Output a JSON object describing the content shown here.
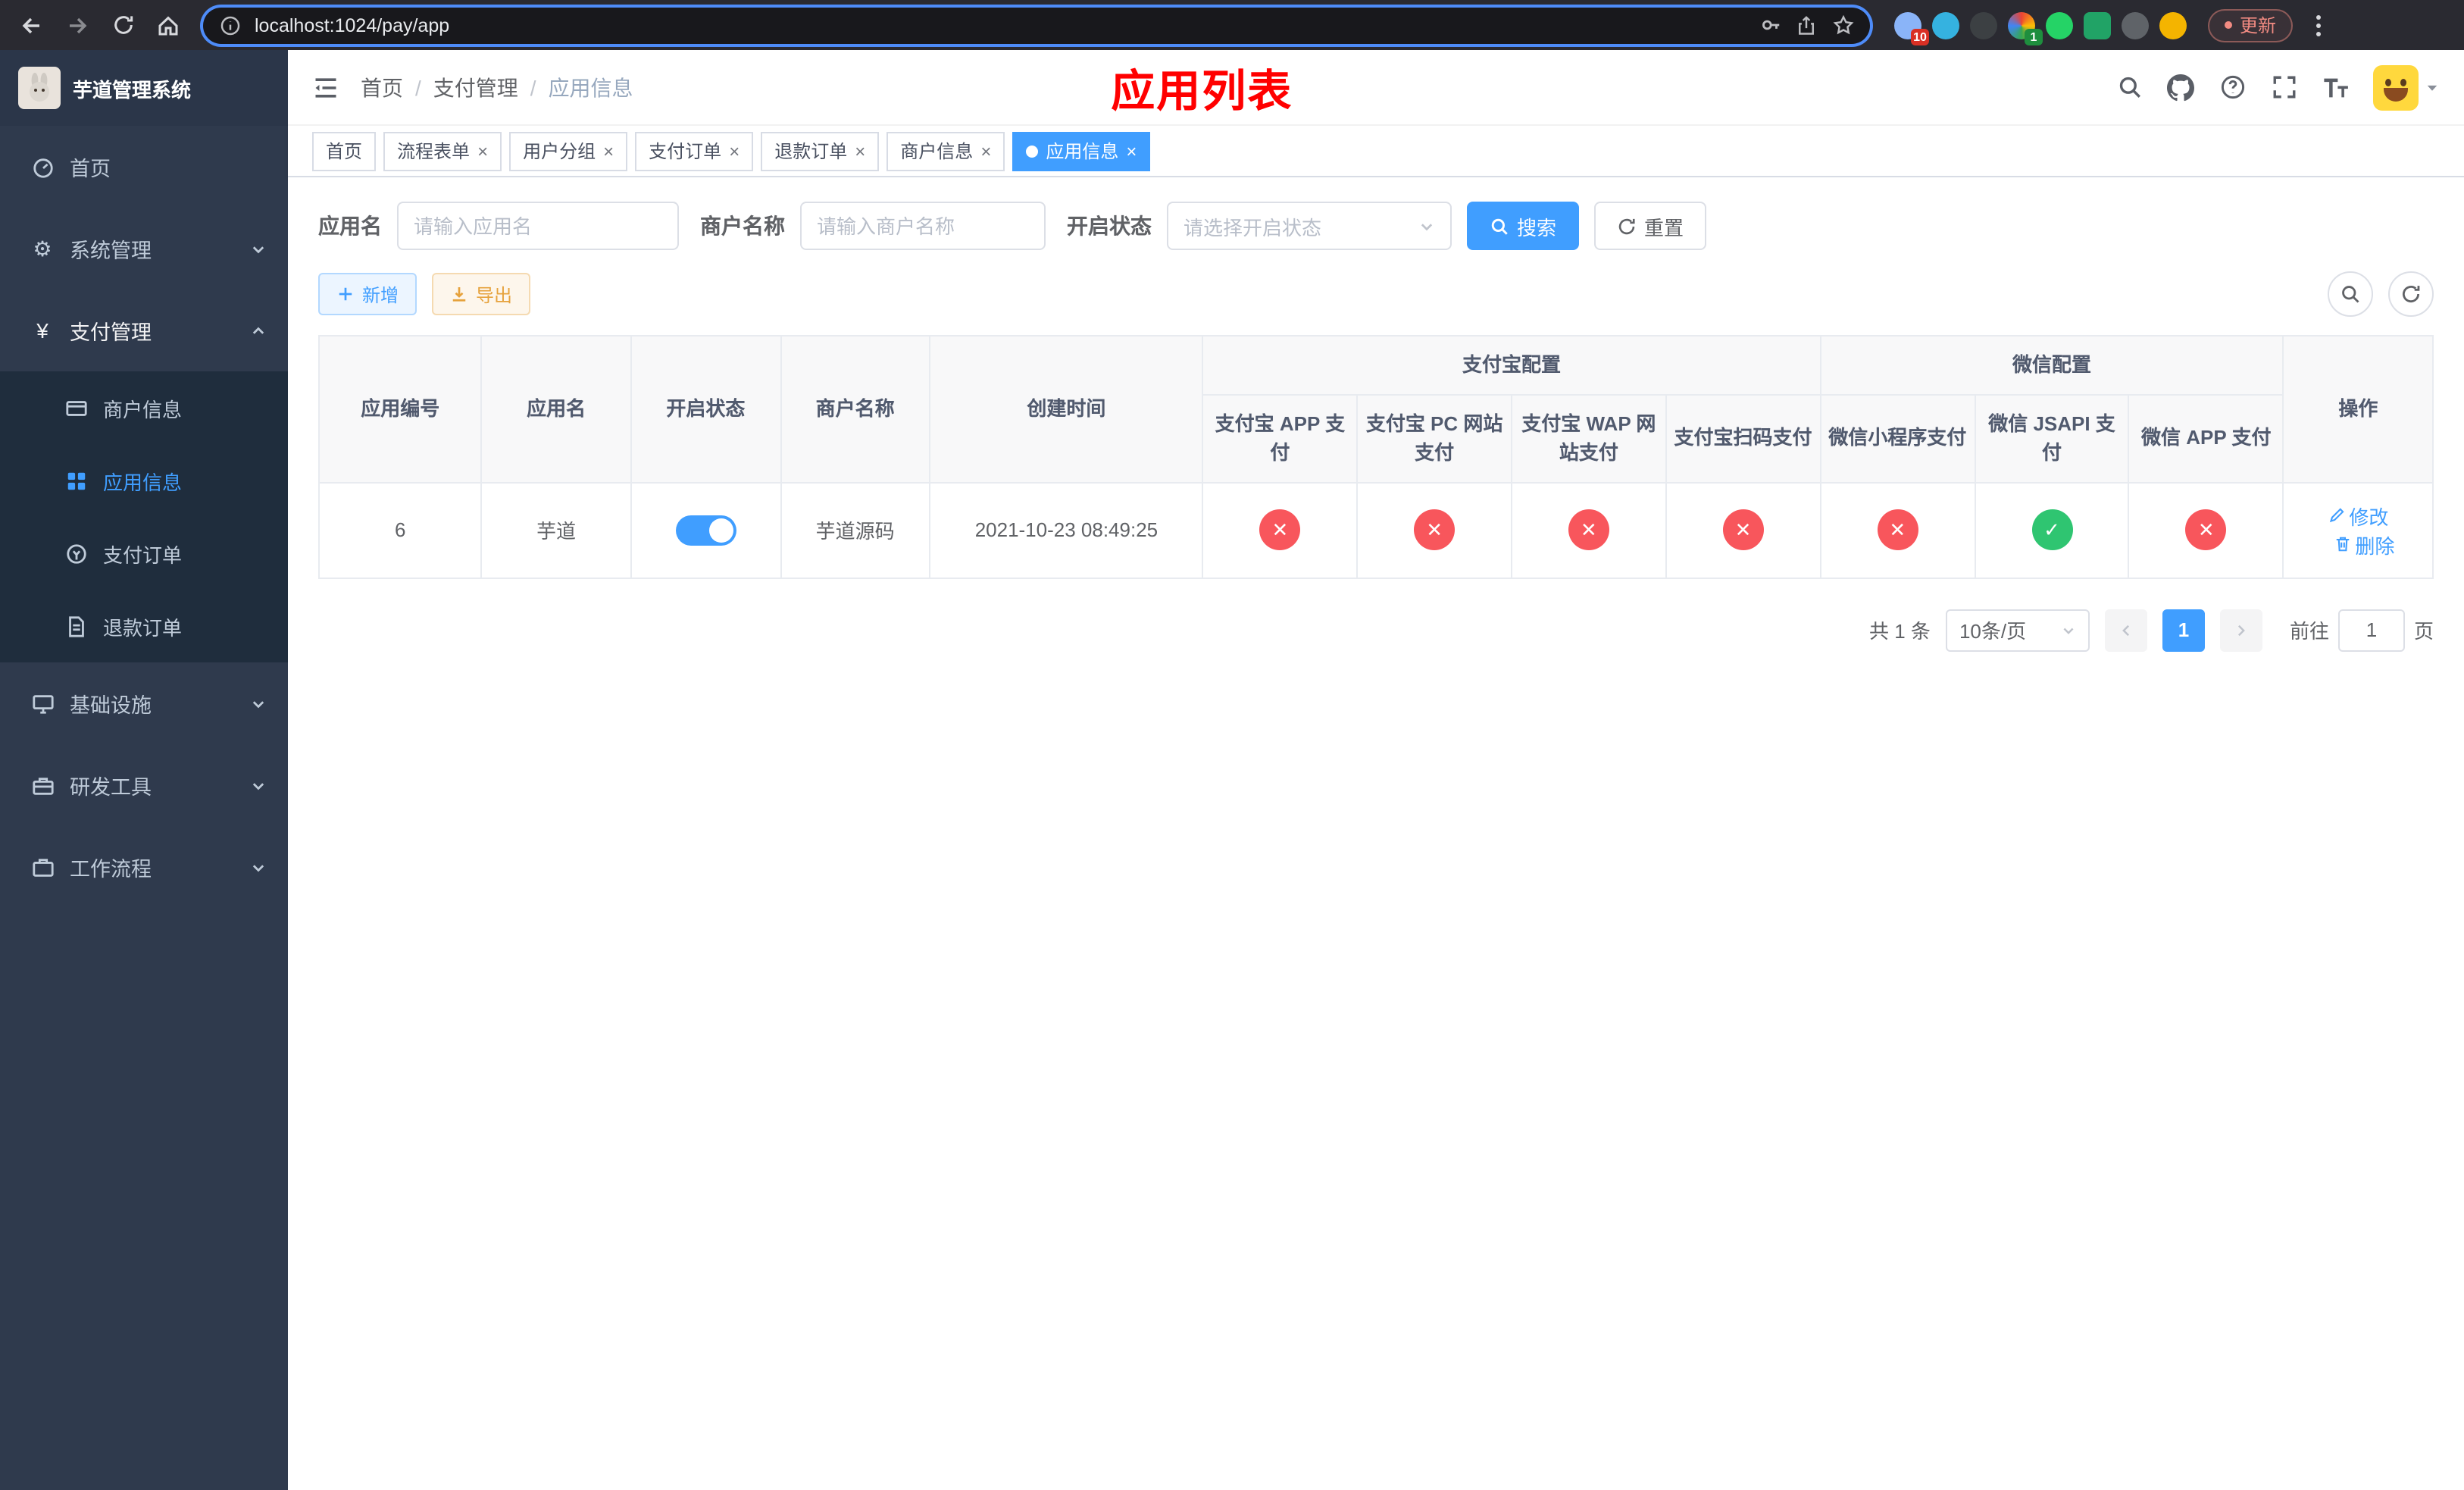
{
  "colors": {
    "primary": "#409eff",
    "danger": "#f8565c",
    "success": "#2fc571",
    "title": "#ff0000"
  },
  "browser": {
    "url": "localhost:1024/pay/app",
    "update_label": "更新",
    "ext_badge_red": "10",
    "ext_badge_green": "1"
  },
  "sidebar": {
    "title": "芋道管理系统",
    "home": "首页",
    "system": "系统管理",
    "payment": "支付管理",
    "sub_merchant": "商户信息",
    "sub_app": "应用信息",
    "sub_order": "支付订单",
    "sub_refund": "退款订单",
    "infra": "基础设施",
    "devtools": "研发工具",
    "workflow": "工作流程"
  },
  "navbar": {
    "breadcrumb": [
      "首页",
      "支付管理",
      "应用信息"
    ],
    "title": "应用列表"
  },
  "tabs": [
    {
      "label": "首页"
    },
    {
      "label": "流程表单"
    },
    {
      "label": "用户分组"
    },
    {
      "label": "支付订单"
    },
    {
      "label": "退款订单"
    },
    {
      "label": "商户信息"
    },
    {
      "label": "应用信息"
    }
  ],
  "filters": {
    "app_name_label": "应用名",
    "app_name_placeholder": "请输入应用名",
    "merchant_label": "商户名称",
    "merchant_placeholder": "请输入商户名称",
    "status_label": "开启状态",
    "status_placeholder": "请选择开启状态",
    "search_label": "搜索",
    "reset_label": "重置"
  },
  "toolbar": {
    "add_label": "新增",
    "export_label": "导出"
  },
  "table": {
    "group_alipay": "支付宝配置",
    "group_wechat": "微信配置",
    "col_id": "应用编号",
    "col_name": "应用名",
    "col_status": "开启状态",
    "col_merchant": "商户名称",
    "col_created": "创建时间",
    "col_actions": "操作",
    "sub_headers": [
      "支付宝 APP 支付",
      "支付宝 PC 网站支付",
      "支付宝 WAP 网站支付",
      "支付宝扫码支付",
      "微信小程序支付",
      "微信 JSAPI 支付",
      "微信 APP 支付"
    ],
    "row": {
      "id": "6",
      "name": "芋道",
      "enabled": true,
      "merchant": "芋道源码",
      "created": "2021-10-23 08:49:25",
      "statuses": [
        "cross",
        "cross",
        "cross",
        "cross",
        "cross",
        "check",
        "cross"
      ],
      "edit_label": "修改",
      "delete_label": "删除"
    }
  },
  "pagination": {
    "total": "共 1 条",
    "page_size": "10条/页",
    "page": "1",
    "goto_prefix": "前往",
    "goto_value": "1",
    "goto_suffix": "页"
  }
}
